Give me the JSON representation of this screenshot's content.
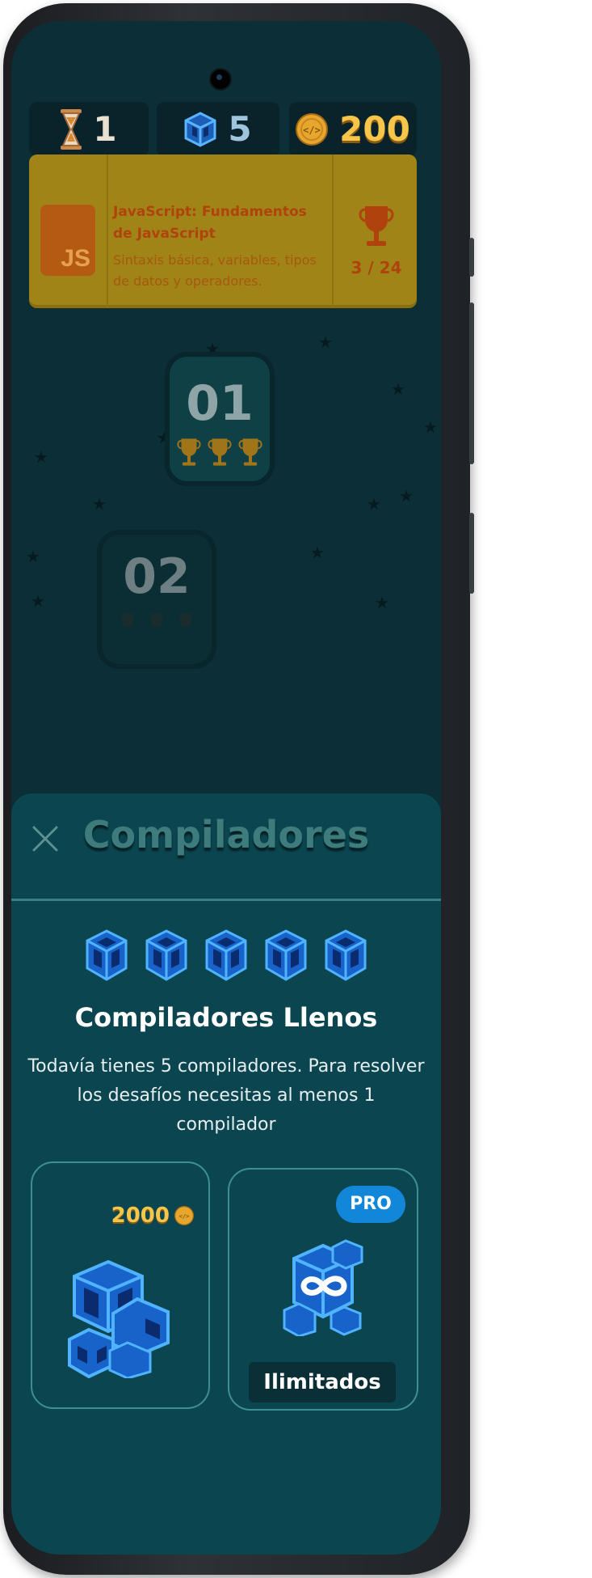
{
  "stats": {
    "hourglass_icon": "hourglass-icon",
    "hourglass_count": "1",
    "compiler_icon": "compiler-cube-icon",
    "compiler_count": "5",
    "coin_icon": "code-coin-icon",
    "coin_count": "200"
  },
  "lesson": {
    "logo": "JS",
    "title": "JavaScript: Fundamentos de JavaScript",
    "description": "Sintaxis básica, variables, tipos de datos y operadores.",
    "progress": "3 / 24",
    "trophy_icon": "trophy-icon"
  },
  "levels": [
    {
      "number": "01",
      "trophies_earned": 3
    },
    {
      "number": "02",
      "trophies_earned": 0
    }
  ],
  "sheet": {
    "title": "Compiladores",
    "close_icon": "close-icon",
    "compiler_count": 5,
    "heading": "Compiladores Llenos",
    "message": "Todavía tienes 5 compiladores. Para resolver los desafíos necesitas al menos 1 compilador",
    "buy_option": {
      "price": "2000",
      "price_icon": "code-coin-icon",
      "icon": "compiler-pack-icon"
    },
    "pro_option": {
      "badge": "PRO",
      "label": "Ilimitados",
      "icon": "infinite-compiler-icon"
    }
  },
  "colors": {
    "screen_bg": "#0c2e36",
    "sheet_bg": "#0b4650",
    "lesson_card": "#a08417",
    "accent_blue": "#1287d9",
    "coin_gold": "#f5c64a"
  }
}
